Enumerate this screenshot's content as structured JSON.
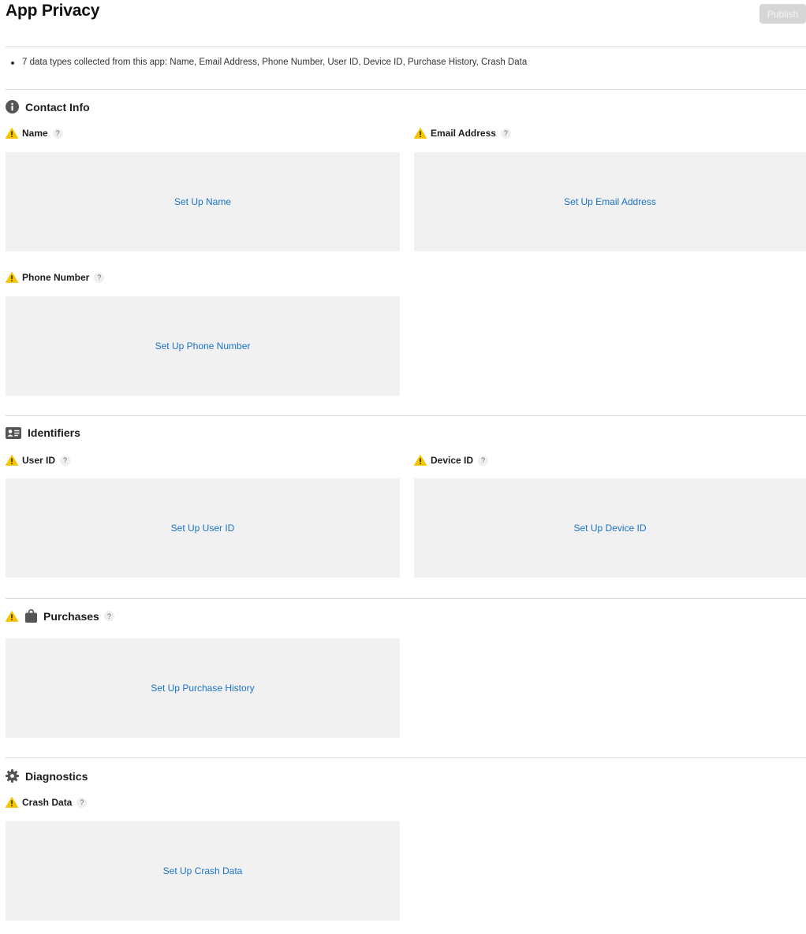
{
  "page": {
    "title": "App Privacy",
    "publish_label": "Publish"
  },
  "summary": {
    "text": "7 data types collected from this app: Name, Email Address, Phone Number, User ID, Device ID, Purchase History, Crash Data"
  },
  "icons": {
    "warning": "warning-icon",
    "help": "?",
    "contact_info": "info-icon",
    "identifiers": "id-card-icon",
    "purchases": "shopping-bag-icon",
    "diagnostics": "gear-icon"
  },
  "colors": {
    "link": "#1a73c8",
    "warning": "#f5c400",
    "box": "#f1f1f1",
    "publish_disabled": "#d6d6d6"
  },
  "sections": {
    "contact_info": {
      "title": "Contact Info",
      "items": [
        {
          "label": "Name",
          "action": "Set Up Name"
        },
        {
          "label": "Email Address",
          "action": "Set Up Email Address"
        },
        {
          "label": "Phone Number",
          "action": "Set Up Phone Number"
        }
      ]
    },
    "identifiers": {
      "title": "Identifiers",
      "items": [
        {
          "label": "User ID",
          "action": "Set Up User ID"
        },
        {
          "label": "Device ID",
          "action": "Set Up Device ID"
        }
      ]
    },
    "purchases": {
      "title": "Purchases",
      "items": [
        {
          "action": "Set Up Purchase History"
        }
      ]
    },
    "diagnostics": {
      "title": "Diagnostics",
      "items": [
        {
          "label": "Crash Data",
          "action": "Set Up Crash Data"
        }
      ]
    }
  }
}
